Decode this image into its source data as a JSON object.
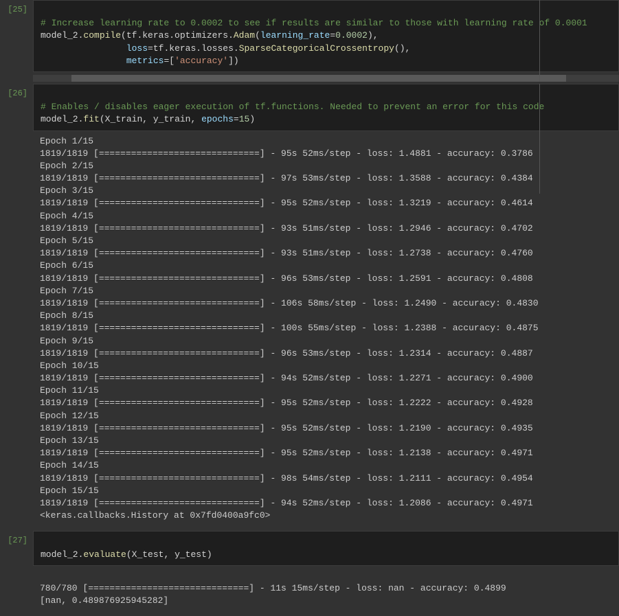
{
  "cells": [
    {
      "prompt": "[25]",
      "code": {
        "comment": "# Increase learning rate to 0.0002 to see if results are similar to those with learning rate of 0.0001",
        "line2_pre": "model_2.",
        "line2_compile": "compile",
        "line2_p1": "(",
        "line2_tf": "tf.keras.optimizers.",
        "line2_adam": "Adam",
        "line2_p2": "(",
        "line2_lr_param": "learning_rate",
        "line2_eq": "=",
        "line2_lr_val": "0.0002",
        "line2_close": "),",
        "line3_pad": "                ",
        "line3_loss_param": "loss",
        "line3_eq": "=",
        "line3_loss_path": "tf.keras.losses.",
        "line3_loss_cls": "SparseCategoricalCrossentropy",
        "line3_close": "(),",
        "line4_pad": "                ",
        "line4_metrics_param": "metrics",
        "line4_eq": "=",
        "line4_open": "[",
        "line4_str": "'accuracy'",
        "line4_close": "])"
      }
    },
    {
      "prompt": "[26]",
      "code": {
        "comment": "# Enables / disables eager execution of tf.functions. Needed to prevent an error for this code",
        "line2_pre": "model_2.",
        "line2_fit": "fit",
        "line2_open": "(",
        "line2_x": "X_train",
        "line2_c1": ", ",
        "line2_y": "y_train",
        "line2_c2": ", ",
        "line2_epochs_param": "epochs",
        "line2_eq": "=",
        "line2_epochs_val": "15",
        "line2_close": ")"
      },
      "output_lines": [
        "Epoch 1/15",
        "1819/1819 [==============================] - 95s 52ms/step - loss: 1.4881 - accuracy: 0.3786",
        "Epoch 2/15",
        "1819/1819 [==============================] - 97s 53ms/step - loss: 1.3588 - accuracy: 0.4384",
        "Epoch 3/15",
        "1819/1819 [==============================] - 95s 52ms/step - loss: 1.3219 - accuracy: 0.4614",
        "Epoch 4/15",
        "1819/1819 [==============================] - 93s 51ms/step - loss: 1.2946 - accuracy: 0.4702",
        "Epoch 5/15",
        "1819/1819 [==============================] - 93s 51ms/step - loss: 1.2738 - accuracy: 0.4760",
        "Epoch 6/15",
        "1819/1819 [==============================] - 96s 53ms/step - loss: 1.2591 - accuracy: 0.4808",
        "Epoch 7/15",
        "1819/1819 [==============================] - 106s 58ms/step - loss: 1.2490 - accuracy: 0.4830",
        "Epoch 8/15",
        "1819/1819 [==============================] - 100s 55ms/step - loss: 1.2388 - accuracy: 0.4875",
        "Epoch 9/15",
        "1819/1819 [==============================] - 96s 53ms/step - loss: 1.2314 - accuracy: 0.4887",
        "Epoch 10/15",
        "1819/1819 [==============================] - 94s 52ms/step - loss: 1.2271 - accuracy: 0.4900",
        "Epoch 11/15",
        "1819/1819 [==============================] - 95s 52ms/step - loss: 1.2222 - accuracy: 0.4928",
        "Epoch 12/15",
        "1819/1819 [==============================] - 95s 52ms/step - loss: 1.2190 - accuracy: 0.4935",
        "Epoch 13/15",
        "1819/1819 [==============================] - 95s 52ms/step - loss: 1.2138 - accuracy: 0.4971",
        "Epoch 14/15",
        "1819/1819 [==============================] - 98s 54ms/step - loss: 1.2111 - accuracy: 0.4954",
        "Epoch 15/15",
        "1819/1819 [==============================] - 94s 52ms/step - loss: 1.2086 - accuracy: 0.4971",
        "<keras.callbacks.History at 0x7fd0400a9fc0>"
      ]
    },
    {
      "prompt": "[27]",
      "code": {
        "line1_pre": "model_2.",
        "line1_eval": "evaluate",
        "line1_open": "(",
        "line1_x": "X_test",
        "line1_c1": ", ",
        "line1_y": "y_test",
        "line1_close": ")"
      },
      "output_lines": [
        "780/780 [==============================] - 11s 15ms/step - loss: nan - accuracy: 0.4899",
        "[nan, 0.489876925945282]"
      ]
    }
  ]
}
